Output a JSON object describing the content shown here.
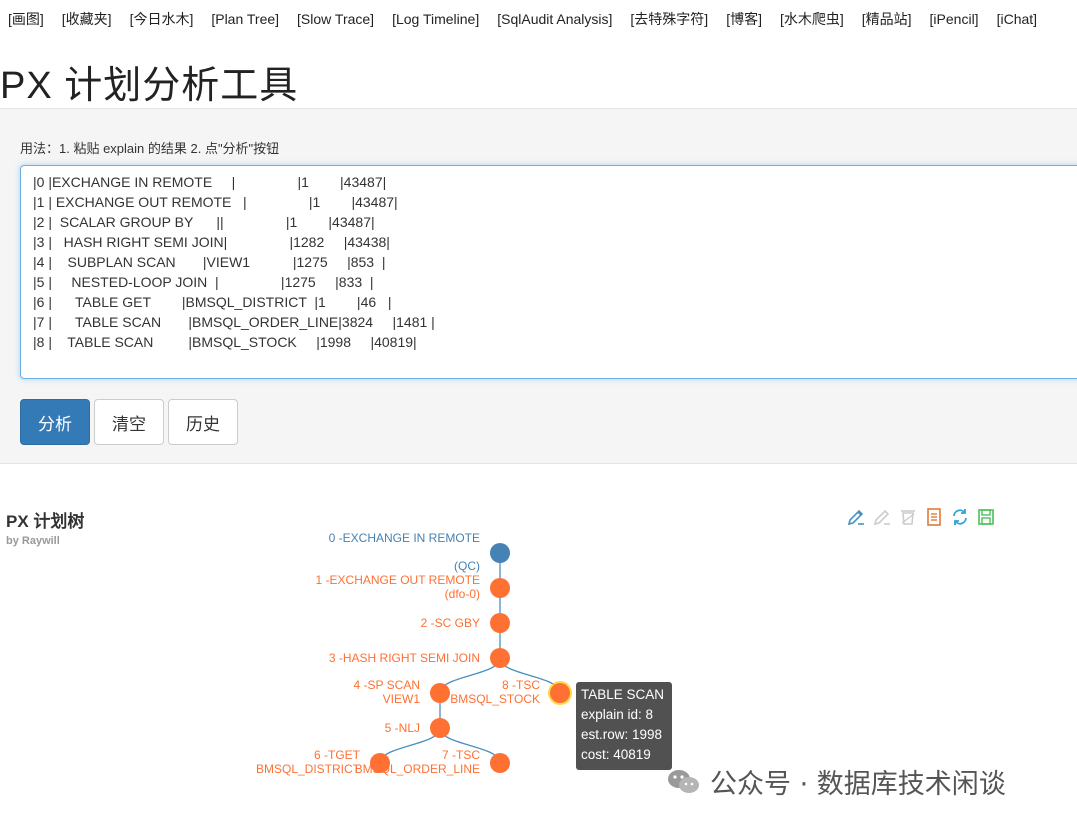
{
  "nav": [
    "[画图]",
    "[收藏夹]",
    "[今日水木]",
    "[Plan Tree]",
    "[Slow Trace]",
    "[Log Timeline]",
    "[SqlAudit Analysis]",
    "[去特殊字符]",
    "[博客]",
    "[水木爬虫]",
    "[精品站]",
    "[iPencil]",
    "[iChat]"
  ],
  "page_title": "PX 计划分析工具",
  "usage": "用法：1. 粘贴 explain 的结果 2. 点\"分析\"按钮",
  "plan_text": "|0 |EXCHANGE IN REMOTE     |                |1        |43487|\n|1 | EXCHANGE OUT REMOTE   |                |1        |43487|\n|2 |  SCALAR GROUP BY      ||                |1        |43487|\n|3 |   HASH RIGHT SEMI JOIN|                |1282     |43438|\n|4 |    SUBPLAN SCAN       |VIEW1           |1275     |853  |\n|5 |     NESTED-LOOP JOIN  |                |1275     |833  |\n|6 |      TABLE GET        |BMSQL_DISTRICT  |1        |46   |\n|7 |      TABLE SCAN       |BMSQL_ORDER_LINE|3824     |1481 |\n|8 |    TABLE SCAN         |BMSQL_STOCK     |1998     |40819|",
  "buttons": {
    "analyze": "分析",
    "clear": "清空",
    "history": "历史"
  },
  "tree": {
    "title": "PX 计划树",
    "subtitle": "by Raywill",
    "nodes": [
      {
        "id": 0,
        "label": "0 -EXCHANGE IN REMOTE",
        "label2": "(QC)",
        "color": "#4682b4"
      },
      {
        "id": 1,
        "label": "1 -EXCHANGE OUT REMOTE",
        "label2": "(dfo-0)",
        "color": "#ff7033"
      },
      {
        "id": 2,
        "label": "2 -SC GBY",
        "label2": "",
        "color": "#ff7033"
      },
      {
        "id": 3,
        "label": "3 -HASH RIGHT SEMI JOIN",
        "label2": "",
        "color": "#ff7033"
      },
      {
        "id": 4,
        "label": "4 -SP SCAN",
        "label2": "VIEW1",
        "color": "#ff7033"
      },
      {
        "id": 8,
        "label": "8 -TSC",
        "label2": "BMSQL_STOCK",
        "color": "#ff7033"
      },
      {
        "id": 5,
        "label": "5 -NLJ",
        "label2": "",
        "color": "#ff7033"
      },
      {
        "id": 6,
        "label": "6 -TGET",
        "label2": "BMSQL_DISTRICT",
        "color": "#ff7033"
      },
      {
        "id": 7,
        "label": "7 -TSC",
        "label2": "BMSQL_ORDER_LINE",
        "color": "#ff7033"
      }
    ],
    "edges": [
      [
        0,
        1
      ],
      [
        1,
        2
      ],
      [
        2,
        3
      ],
      [
        3,
        4
      ],
      [
        3,
        8
      ],
      [
        4,
        5
      ],
      [
        5,
        6
      ],
      [
        5,
        7
      ]
    ],
    "highlight": 8
  },
  "tooltip": {
    "title": "TABLE SCAN",
    "explain_id": "explain id: 8",
    "est_row": "est.row: 1998",
    "cost": "cost: 40819"
  },
  "watermark": "公众号 · 数据库技术闲谈",
  "colors": {
    "primary": "#337ab7",
    "node_root": "#4682b4",
    "node": "#ff7033",
    "link": "#4a90c2"
  },
  "icons": [
    "pencil-icon",
    "pencil-off-icon",
    "eraser-icon",
    "document-icon",
    "refresh-icon",
    "save-icon"
  ]
}
